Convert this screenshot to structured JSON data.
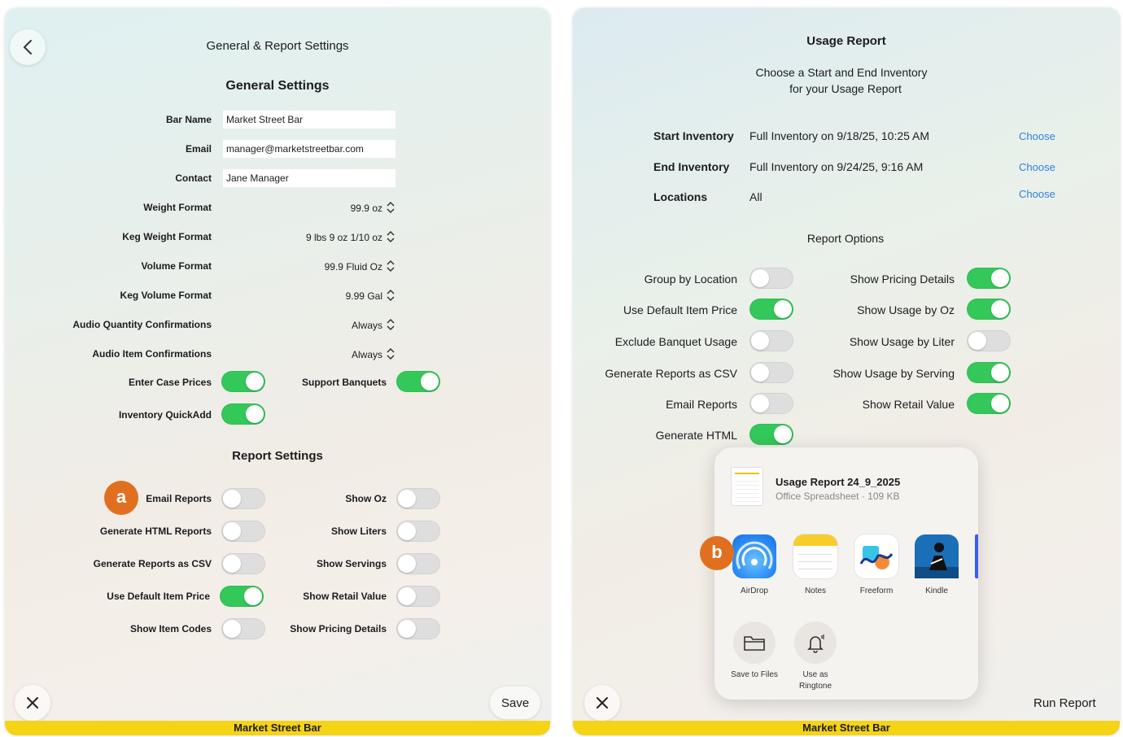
{
  "left": {
    "title": "General & Report Settings",
    "general_heading": "General Settings",
    "fields": [
      {
        "label": "Bar Name",
        "value": "Market Street Bar"
      },
      {
        "label": "Email",
        "value": "manager@marketstreetbar.com"
      },
      {
        "label": "Contact",
        "value": "Jane Manager"
      }
    ],
    "steppers": [
      {
        "label": "Weight Format",
        "value": "99.9 oz"
      },
      {
        "label": "Keg Weight Format",
        "value": "9 lbs 9 oz 1/10 oz"
      },
      {
        "label": "Volume Format",
        "value": "99.9 Fluid Oz"
      },
      {
        "label": "Keg Volume Format",
        "value": "9.99 Gal"
      },
      {
        "label": "Audio Quantity Confirmations",
        "value": "Always"
      },
      {
        "label": "Audio Item Confirmations",
        "value": "Always"
      }
    ],
    "general_toggles": [
      {
        "label": "Enter Case Prices",
        "on": true
      },
      {
        "label": "Support Banquets",
        "on": true
      },
      {
        "label": "Inventory QuickAdd",
        "on": true
      }
    ],
    "report_heading": "Report Settings",
    "report_toggles_left": [
      {
        "label": "Email Reports",
        "on": false
      },
      {
        "label": "Generate HTML Reports",
        "on": false
      },
      {
        "label": "Generate Reports as CSV",
        "on": false
      },
      {
        "label": "Use Default Item Price",
        "on": true
      },
      {
        "label": "Show Item Codes",
        "on": false
      }
    ],
    "report_toggles_right": [
      {
        "label": "Show Oz",
        "on": false
      },
      {
        "label": "Show Liters",
        "on": false
      },
      {
        "label": "Show Servings",
        "on": false
      },
      {
        "label": "Show Retail Value",
        "on": false
      },
      {
        "label": "Show Pricing Details",
        "on": false
      }
    ],
    "badge": "a",
    "save_label": "Save",
    "footer": "Market Street Bar"
  },
  "right": {
    "title": "Usage Report",
    "subtitle_line1": "Choose a Start and End Inventory",
    "subtitle_line2": "for your Usage Report",
    "rows": [
      {
        "label": "Start Inventory",
        "value": "Full Inventory on 9/18/25, 10:25 AM",
        "action": "Choose"
      },
      {
        "label": "End Inventory",
        "value": "Full Inventory on 9/24/25, 9:16 AM",
        "action": "Choose"
      },
      {
        "label": "Locations",
        "value": "All",
        "action": "Choose"
      }
    ],
    "options_heading": "Report Options",
    "options_left": [
      {
        "label": "Group by Location",
        "on": false
      },
      {
        "label": "Use Default Item Price",
        "on": true
      },
      {
        "label": "Exclude Banquet Usage",
        "on": false
      },
      {
        "label": "Generate Reports as CSV",
        "on": false
      },
      {
        "label": "Email Reports",
        "on": false
      },
      {
        "label": "Generate HTML",
        "on": true
      }
    ],
    "options_right": [
      {
        "label": "Show Pricing Details",
        "on": true
      },
      {
        "label": "Show Usage by Oz",
        "on": true
      },
      {
        "label": "Show Usage by Liter",
        "on": false
      },
      {
        "label": "Show Usage by Serving",
        "on": true
      },
      {
        "label": "Show Retail Value",
        "on": true
      }
    ],
    "share": {
      "file_name": "Usage Report 24_9_2025",
      "file_meta": "Office Spreadsheet · 109 KB",
      "apps": [
        "AirDrop",
        "Notes",
        "Freeform",
        "Kindle"
      ],
      "actions": [
        {
          "label_line1": "Save to Files",
          "label_line2": ""
        },
        {
          "label_line1": "Use as",
          "label_line2": "Ringtone"
        }
      ]
    },
    "badge": "b",
    "run_label": "Run Report",
    "footer": "Market Street Bar"
  }
}
